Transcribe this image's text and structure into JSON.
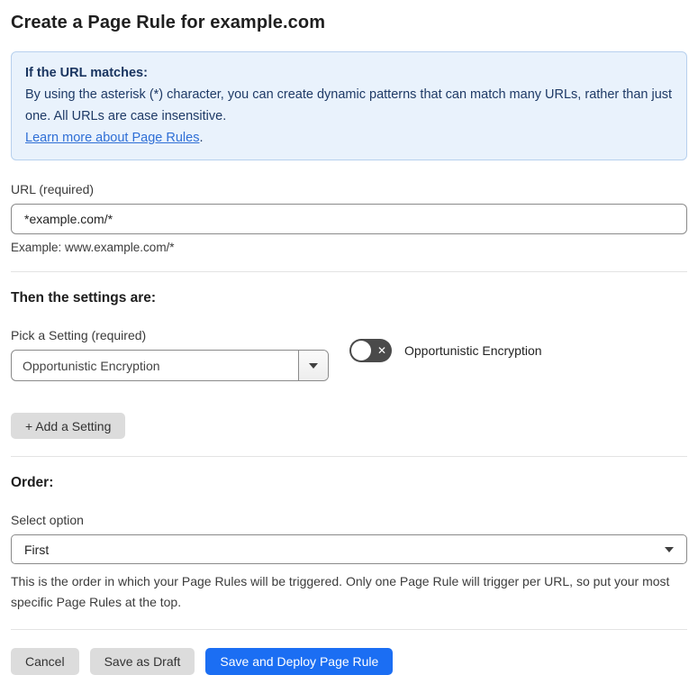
{
  "page": {
    "title": "Create a Page Rule for example.com"
  },
  "info_box": {
    "heading": "If the URL matches:",
    "body": "By using the asterisk (*) character, you can create dynamic patterns that can match many URLs, rather than just one. All URLs are case insensitive.",
    "link_label": "Learn more about Page Rules",
    "link_suffix": "."
  },
  "url_field": {
    "label": "URL (required)",
    "value": "*example.com/*",
    "help": "Example: www.example.com/*"
  },
  "settings_section": {
    "heading": "Then the settings are:",
    "picker_label": "Pick a Setting (required)",
    "picker_value": "Opportunistic Encryption",
    "toggle_label": "Opportunistic Encryption",
    "toggle_state": "off",
    "toggle_off_glyph": "✕",
    "add_button_label": "+ Add a Setting"
  },
  "order_section": {
    "heading": "Order:",
    "select_label": "Select option",
    "select_value": "First",
    "help": "This is the order in which your Page Rules will be triggered. Only one Page Rule will trigger per URL, so put your most specific Page Rules at the top."
  },
  "footer": {
    "cancel_label": "Cancel",
    "save_draft_label": "Save as Draft",
    "save_deploy_label": "Save and Deploy Page Rule"
  },
  "colors": {
    "accent_blue": "#1b6ef3",
    "info_background": "#e9f2fc",
    "info_border": "#b7d0ee",
    "info_text": "#1e3a66",
    "link_blue": "#2f6fd6",
    "toggle_off_background": "#4a4a4a",
    "gray_button": "#dcdcdc"
  }
}
